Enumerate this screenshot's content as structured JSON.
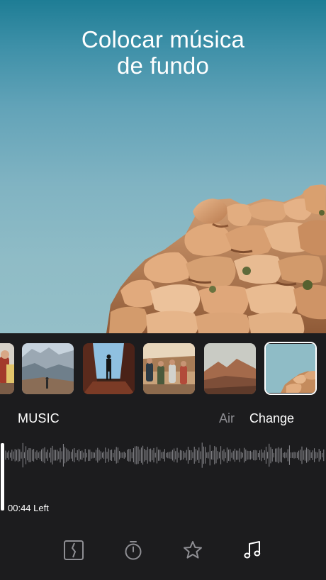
{
  "hero": {
    "title_line1": "Colocar música",
    "title_line2": "de fundo"
  },
  "clips": [
    {
      "name": "people-hiking-clip",
      "selected": false
    },
    {
      "name": "canyon-clip",
      "selected": false
    },
    {
      "name": "hiker-silhouette-clip",
      "selected": false
    },
    {
      "name": "group-hiking-clip",
      "selected": false
    },
    {
      "name": "desert-mountain-clip",
      "selected": false
    },
    {
      "name": "rock-formation-clip",
      "selected": true
    }
  ],
  "music": {
    "label": "MUSIC",
    "track": "Air",
    "change_label": "Change",
    "time_left": "00:44 Left"
  },
  "toolbar": {
    "items": [
      "trim-icon",
      "timer-icon",
      "star-icon",
      "music-note-icon"
    ],
    "active": "music-note-icon"
  },
  "colors": {
    "panel_bg": "#1c1c1e",
    "muted_text": "#8e8e93",
    "waveform": "#8a8a8e",
    "accent": "#ffffff"
  }
}
